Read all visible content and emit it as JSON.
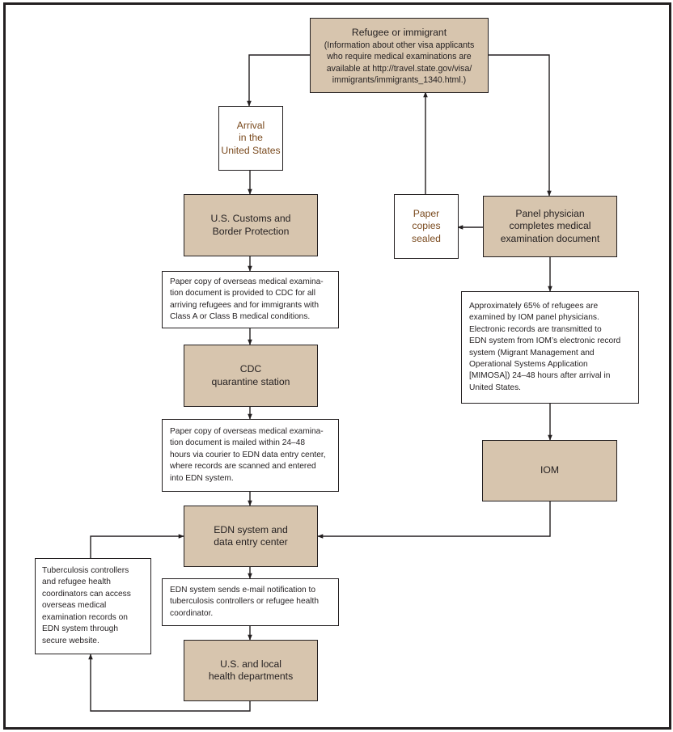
{
  "diagram": {
    "type": "flowchart",
    "colors": {
      "process_fill": "#d7c5ae",
      "note_fill": "#ffffff",
      "stroke": "#231f20",
      "brown_text": "#7a4a1e"
    },
    "nodes": {
      "refugee": {
        "title": "Refugee or immigrant",
        "subtitle": "(Information about other visa applicants\nwho require medical examinations are\navailable at http://travel.state.gov/visa/\nimmigrants/immigrants_1340.html.)"
      },
      "arrival": {
        "label": "Arrival\nin the\nUnited States"
      },
      "customs": {
        "label": "U.S. Customs and\nBorder Protection"
      },
      "note_cdc_copy": {
        "label": "Paper copy of overseas medical examina-\ntion document is provided to CDC for all\narriving refugees and for immigrants with\nClass A or Class B medical conditions."
      },
      "quarantine": {
        "label": "CDC\nquarantine station"
      },
      "note_mailed": {
        "label": "Paper copy of overseas medical examina-\ntion document is mailed within 24–48\nhours via courier to EDN data entry center,\nwhere records are scanned and entered\ninto EDN system."
      },
      "edn": {
        "label": "EDN system and\ndata entry center"
      },
      "note_email": {
        "label": "EDN system sends e-mail notification to\ntuberculosis controllers or refugee health\ncoordinator."
      },
      "health_depts": {
        "label": "U.S. and local\nhealth departments"
      },
      "note_tb": {
        "label": "Tuberculosis controllers\nand refugee health\ncoordinators can access\noverseas medical\nexamination records on\nEDN system through\nsecure website."
      },
      "paper_sealed": {
        "label": "Paper\ncopies\nsealed"
      },
      "panel": {
        "label": "Panel physician\ncompletes medical\nexamination document"
      },
      "note_iom": {
        "label": "Approximately 65% of refugees are\nexamined by IOM panel physicians.\nElectronic records are transmitted to\nEDN system from IOM’s electronic record\nsystem (Migrant Management and\nOperational Systems Application\n[MIMOSA]) 24–48 hours after arrival in\nUnited States."
      },
      "iom": {
        "label": "IOM"
      }
    },
    "edges": [
      {
        "from": "refugee",
        "to": "arrival"
      },
      {
        "from": "refugee",
        "to": "panel"
      },
      {
        "from": "arrival",
        "to": "customs"
      },
      {
        "from": "customs",
        "to": "note_cdc_copy"
      },
      {
        "from": "note_cdc_copy",
        "to": "quarantine"
      },
      {
        "from": "quarantine",
        "to": "note_mailed"
      },
      {
        "from": "note_mailed",
        "to": "edn"
      },
      {
        "from": "edn",
        "to": "note_email"
      },
      {
        "from": "note_email",
        "to": "health_depts"
      },
      {
        "from": "health_depts",
        "to": "note_tb"
      },
      {
        "from": "note_tb",
        "to": "edn"
      },
      {
        "from": "panel",
        "to": "paper_sealed"
      },
      {
        "from": "paper_sealed",
        "to": "refugee"
      },
      {
        "from": "panel",
        "to": "note_iom"
      },
      {
        "from": "note_iom",
        "to": "iom"
      },
      {
        "from": "iom",
        "to": "edn"
      }
    ]
  }
}
